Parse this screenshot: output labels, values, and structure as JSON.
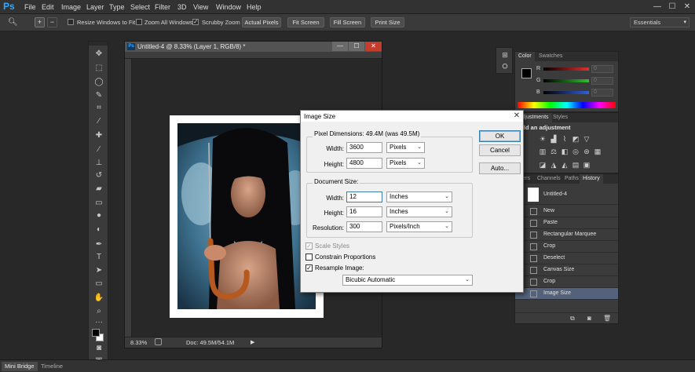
{
  "app": {
    "logo": "Ps"
  },
  "menu": [
    "File",
    "Edit",
    "Image",
    "Layer",
    "Type",
    "Select",
    "Filter",
    "3D",
    "View",
    "Window",
    "Help"
  ],
  "window_controls": {
    "minimize": "—",
    "maximize": "☐",
    "close": "✕"
  },
  "options_bar": {
    "resize_windows": "Resize Windows to Fit",
    "zoom_all": "Zoom All Windows",
    "scrubby_zoom": "Scrubby Zoom",
    "actual_pixels": "Actual Pixels",
    "fit_screen": "Fit Screen",
    "fill_screen": "Fill Screen",
    "print_size": "Print Size",
    "workspace": "Essentials"
  },
  "document": {
    "title": "Untitled-4 @ 8.33% (Layer 1, RGB/8) *",
    "zoom": "8.33%",
    "doc_info": "Doc: 49.5M/54.1M"
  },
  "bottom_tabs": [
    "Mini Bridge",
    "Timeline"
  ],
  "color_panel": {
    "tabs": [
      "Color",
      "Swatches"
    ],
    "sliders": [
      {
        "label": "R",
        "value": "0",
        "color": "#e03030"
      },
      {
        "label": "G",
        "value": "0",
        "color": "#30c030"
      },
      {
        "label": "B",
        "value": "0",
        "color": "#3060e0"
      }
    ]
  },
  "adjustments_panel": {
    "tabs": [
      "Adjustments",
      "Styles"
    ],
    "heading": "Add an adjustment"
  },
  "history_panel": {
    "tabs": [
      "Layers",
      "Channels",
      "Paths",
      "History"
    ],
    "snapshot": "Untitled-4",
    "items": [
      "New",
      "Paste",
      "Rectangular Marquee",
      "Crop",
      "Deselect",
      "Canvas Size",
      "Crop",
      "Image Size"
    ],
    "selected_index": 7
  },
  "dialog": {
    "title": "Image Size",
    "pixel_dimensions": {
      "title": "Pixel Dimensions:",
      "summary": "49.4M (was 49.5M)",
      "width_label": "Width:",
      "width_value": "3600",
      "width_unit": "Pixels",
      "height_label": "Height:",
      "height_value": "4800",
      "height_unit": "Pixels"
    },
    "document_size": {
      "title": "Document Size:",
      "width_label": "Width:",
      "width_value": "12",
      "width_unit": "Inches",
      "height_label": "Height:",
      "height_value": "16",
      "height_unit": "Inches",
      "resolution_label": "Resolution:",
      "resolution_value": "300",
      "resolution_unit": "Pixels/Inch"
    },
    "scale_styles": "Scale Styles",
    "constrain_proportions": "Constrain Proportions",
    "resample_image": "Resample Image:",
    "resample_method": "Bicubic Automatic",
    "buttons": {
      "ok": "OK",
      "cancel": "Cancel",
      "auto": "Auto..."
    }
  }
}
